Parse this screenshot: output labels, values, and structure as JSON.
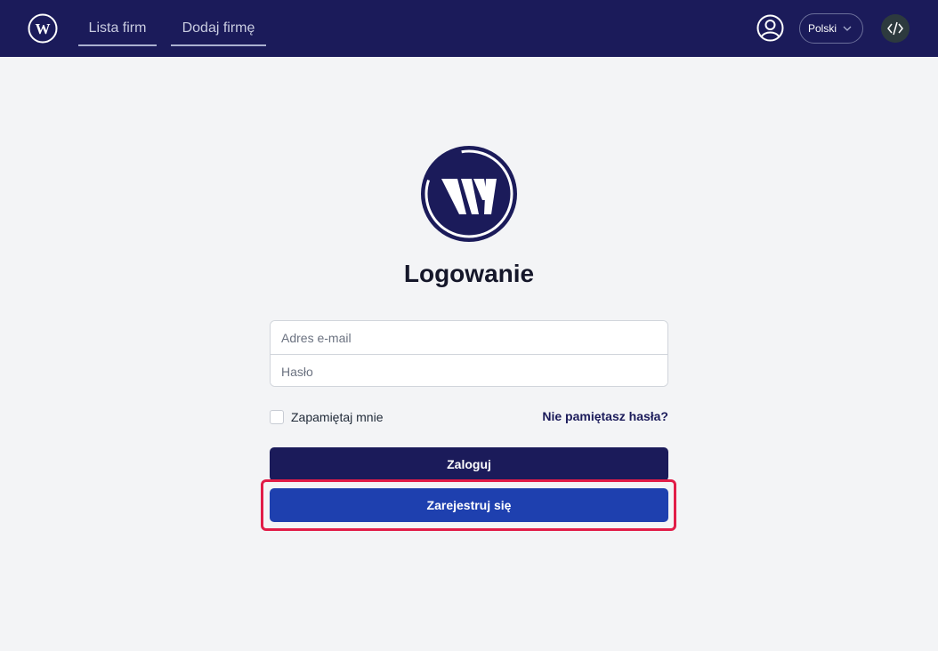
{
  "nav": {
    "links": [
      {
        "label": "Lista firm"
      },
      {
        "label": "Dodaj firmę"
      }
    ],
    "language": "Polski",
    "logo_icon": "w-logo-icon",
    "user_icon": "user-icon",
    "code_icon": "code-icon"
  },
  "main": {
    "title": "Logowanie",
    "email_placeholder": "Adres e-mail",
    "password_placeholder": "Hasło",
    "remember_label": "Zapamiętaj mnie",
    "forgot_label": "Nie pamiętasz hasła?",
    "login_label": "Zaloguj",
    "register_label": "Zarejestruj się"
  },
  "colors": {
    "navbar": "#1b1b5a",
    "background": "#f3f4f6",
    "login_button": "#1b1b5a",
    "register_button": "#1e40af",
    "highlight": "#e11d48"
  }
}
